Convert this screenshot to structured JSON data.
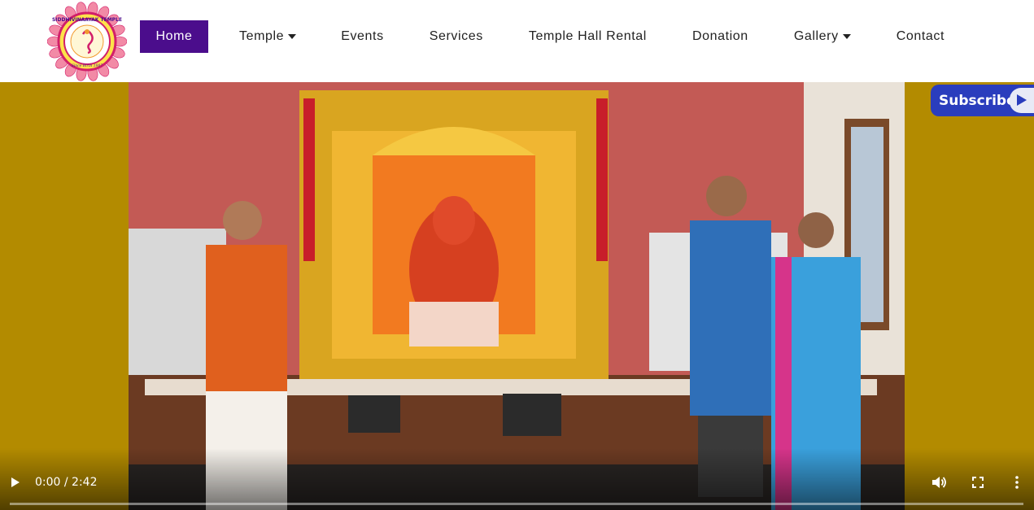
{
  "logo": {
    "name": "SIDDHIVINAAYAK TEMPLE",
    "tagline": "Since Birth 1987",
    "ring_color": "#d21f6a",
    "petal_color": "#f28aa6"
  },
  "nav": {
    "items": [
      {
        "label": "Home",
        "active": true,
        "dropdown": false
      },
      {
        "label": "Temple",
        "active": false,
        "dropdown": true
      },
      {
        "label": "Events",
        "active": false,
        "dropdown": false
      },
      {
        "label": "Services",
        "active": false,
        "dropdown": false
      },
      {
        "label": "Temple Hall Rental",
        "active": false,
        "dropdown": false
      },
      {
        "label": "Donation",
        "active": false,
        "dropdown": false
      },
      {
        "label": "Gallery",
        "active": false,
        "dropdown": true
      },
      {
        "label": "Contact",
        "active": false,
        "dropdown": false
      }
    ],
    "active_color": "#4b0d8c"
  },
  "video": {
    "background_color": "#b38b00",
    "time_display": "0:00 / 2:42",
    "progress": 0,
    "icons": [
      "play-icon",
      "volume-icon",
      "fullscreen-icon",
      "more-vert-icon"
    ]
  },
  "subscribe": {
    "label": "Subscribe",
    "color": "#2a3dbd"
  }
}
